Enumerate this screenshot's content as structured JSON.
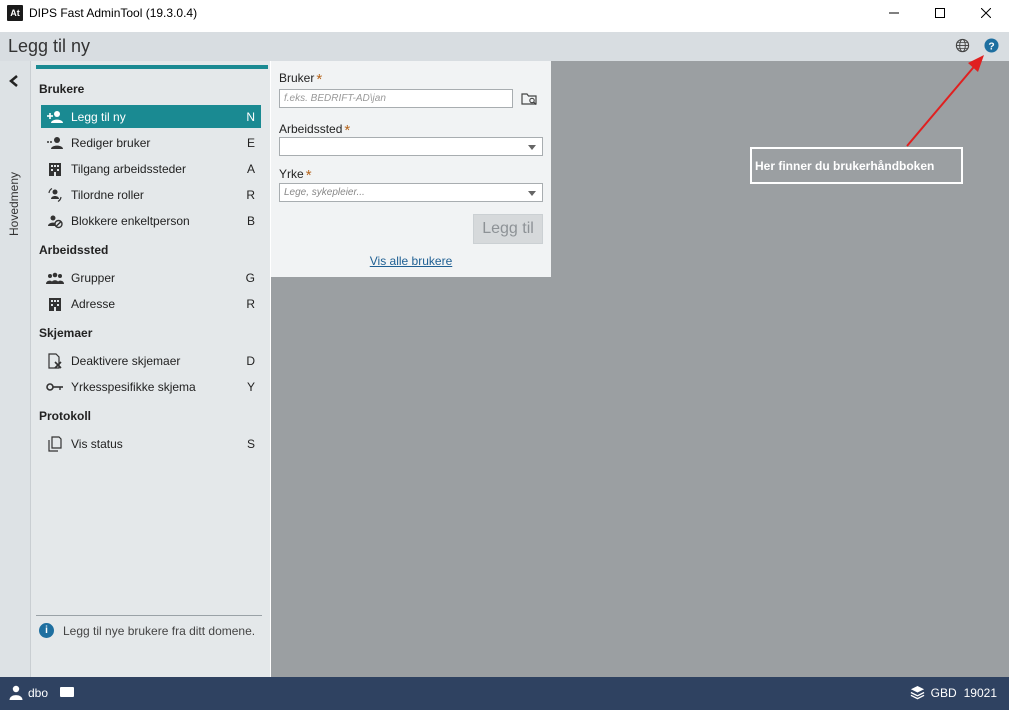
{
  "window": {
    "badge": "At",
    "title": "DIPS Fast AdminTool (19.3.0.4)"
  },
  "header": {
    "title": "Legg til ny"
  },
  "rail": {
    "label": "Hovedmeny"
  },
  "nav": {
    "sections": [
      {
        "title": "Brukere",
        "items": [
          {
            "label": "Legg til ny",
            "key": "N",
            "icon": "add-user-icon",
            "active": true
          },
          {
            "label": "Rediger bruker",
            "key": "E",
            "icon": "edit-user-icon"
          },
          {
            "label": "Tilgang arbeidssteder",
            "key": "A",
            "icon": "building-icon"
          },
          {
            "label": "Tilordne roller",
            "key": "R",
            "icon": "assign-roles-icon"
          },
          {
            "label": "Blokkere enkeltperson",
            "key": "B",
            "icon": "block-person-icon"
          }
        ]
      },
      {
        "title": "Arbeidssted",
        "items": [
          {
            "label": "Grupper",
            "key": "G",
            "icon": "group-icon"
          },
          {
            "label": "Adresse",
            "key": "R",
            "icon": "building-icon"
          }
        ]
      },
      {
        "title": "Skjemaer",
        "items": [
          {
            "label": "Deaktivere skjemaer",
            "key": "D",
            "icon": "deactivate-form-icon"
          },
          {
            "label": "Yrkesspesifikke skjema",
            "key": "Y",
            "icon": "key-icon"
          }
        ]
      },
      {
        "title": "Protokoll",
        "items": [
          {
            "label": "Vis status",
            "key": "S",
            "icon": "document-icon"
          }
        ]
      }
    ],
    "info": "Legg til nye brukere fra ditt domene."
  },
  "form": {
    "user_label": "Bruker",
    "user_placeholder": "f.eks. BEDRIFT-AD\\jan",
    "workplace_label": "Arbeidssted",
    "workplace_value": "",
    "profession_label": "Yrke",
    "profession_placeholder": "Lege, sykepleier...",
    "required_mark": "*",
    "add_button": "Legg til",
    "show_all_link": "Vis alle brukere"
  },
  "annotation": {
    "text": "Her finner du brukerhåndboken"
  },
  "statusbar": {
    "user": "dbo",
    "database": "GBD",
    "database_number": "19021"
  },
  "colors": {
    "accent": "#1a8a92",
    "statusbar": "#2f4261",
    "link": "#1e5f93",
    "required": "#b5651d",
    "arrow": "#e02020",
    "help": "#1e6fa0"
  }
}
